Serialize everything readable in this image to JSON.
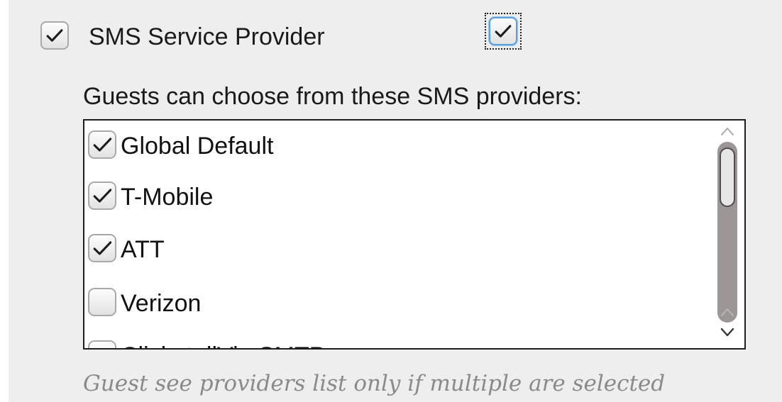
{
  "main_option": {
    "label": "SMS Service Provider",
    "checked": true
  },
  "secondary_toggle": {
    "checked": true,
    "focused": true
  },
  "providers": {
    "caption": "Guests can choose from these SMS providers:",
    "items": [
      {
        "label": "Global Default",
        "checked": true
      },
      {
        "label": "T-Mobile",
        "checked": true
      },
      {
        "label": "ATT",
        "checked": true
      },
      {
        "label": "Verizon",
        "checked": false
      },
      {
        "label": "ClickatellVia SMTP",
        "checked": false
      }
    ]
  },
  "hint": "Guest see providers list only if multiple are selected",
  "icons": {
    "check": "checkmark-icon",
    "scroll_up": "chevron-up-icon",
    "scroll_down": "chevron-down-icon"
  }
}
